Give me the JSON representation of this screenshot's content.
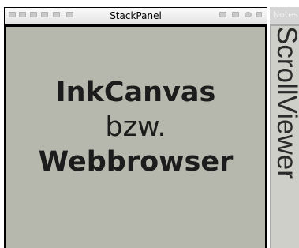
{
  "stackpanel": {
    "title": "StackPanel",
    "content_lines": [
      "InkCanvas",
      "bzw.",
      "Webbrowser"
    ]
  },
  "right_pane": {
    "tab_label": "Notes",
    "scroll_label": "ScrollViewer"
  },
  "colors": {
    "content_background": "#b7b8ad",
    "frame": "#000000",
    "title_bar": "#eeeeee",
    "scroll_background": "#cfcfc9"
  }
}
